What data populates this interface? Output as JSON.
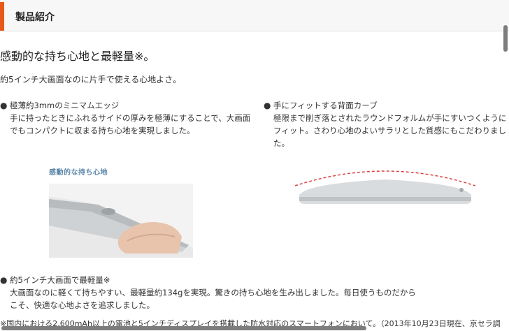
{
  "section": {
    "title": "製品紹介"
  },
  "headline": "感動的な持ち心地と最軽量※。",
  "subline": "約5インチ大画面なのに片手で使える心地よさ。",
  "features": [
    {
      "bullet": "●",
      "title": "極薄約3mmのミニマムエッジ",
      "desc": "手に持ったときにふれるサイドの厚みを極薄にすることで、大画面でもコンパクトに収まる持ち心地を実現しました。"
    },
    {
      "bullet": "●",
      "title": "手にフィットする背面カーブ",
      "desc": "極限まで削ぎ落とされたラウンドフォルムが手にすいつくようにフィット。さわり心地のよいサラリとした質感にもこだわりました。"
    },
    {
      "bullet": "●",
      "title": "約5インチ大画面で最軽量※",
      "desc": "大画面なのに軽くて持ちやすい、最軽量約134gを実現。驚きの持ち心地を生み出しました。毎日使うものだからこそ、快適な心地よさを追求しました。"
    }
  ],
  "image_caption": "感動的な持ち心地",
  "footnote": "※国内における2,600mAh以上の電池と5インチディスプレイを搭載した防水対応のスマートフォンにおいて。（2013年10月23日現在、京セラ調",
  "colors": {
    "accent": "#e8591a",
    "caption": "#5a86a8",
    "curve": "#d94040"
  }
}
